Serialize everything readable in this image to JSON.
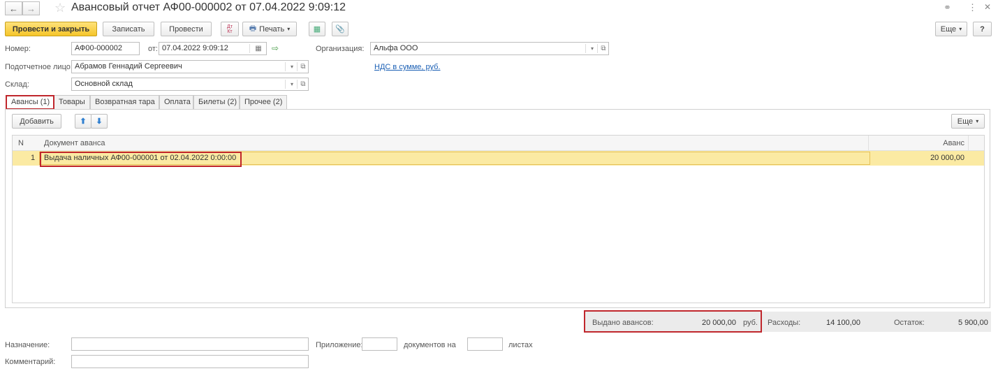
{
  "window": {
    "title": "Авансовый отчет АФ00-000002 от 07.04.2022 9:09:12"
  },
  "toolbar": {
    "post_close": "Провести и закрыть",
    "save": "Записать",
    "post": "Провести",
    "dt_kt": "Дт Кт",
    "print": "Печать",
    "more": "Еще",
    "help": "?"
  },
  "form": {
    "number_label": "Номер:",
    "number_value": "АФ00-000002",
    "date_label": "от:",
    "date_value": "07.04.2022  9:09:12",
    "org_label": "Организация:",
    "org_value": "Альфа ООО",
    "person_label": "Подотчетное лицо:",
    "person_value": "Абрамов Геннадий Сергеевич",
    "vat_link": "НДС в сумме, руб.",
    "warehouse_label": "Склад:",
    "warehouse_value": "Основной склад"
  },
  "tabs": [
    {
      "label": "Авансы (1)",
      "active": true
    },
    {
      "label": "Товары",
      "active": false
    },
    {
      "label": "Возвратная тара",
      "active": false
    },
    {
      "label": "Оплата",
      "active": false
    },
    {
      "label": "Билеты (2)",
      "active": false
    },
    {
      "label": "Прочее (2)",
      "active": false
    }
  ],
  "table_toolbar": {
    "add": "Добавить",
    "more": "Еще"
  },
  "table": {
    "columns": {
      "n": "N",
      "doc": "Документ аванса",
      "amount": "Аванс"
    },
    "rows": [
      {
        "n": "1",
        "doc": "Выдача наличных АФ00-000001 от 02.04.2022 0:00:00",
        "amount": "20 000,00"
      }
    ]
  },
  "totals": {
    "issued_label": "Выдано авансов:",
    "issued_value": "20 000,00",
    "currency": "руб.",
    "expenses_label": "Расходы:",
    "expenses_value": "14 100,00",
    "balance_label": "Остаток:",
    "balance_value": "5 900,00"
  },
  "footer": {
    "purpose_label": "Назначение:",
    "purpose_value": "",
    "attachment_label": "Приложение:",
    "attachment_value": "",
    "docs_on_label": "документов на",
    "sheets_value": "",
    "sheets_label": "листах",
    "comment_label": "Комментарий:",
    "comment_value": ""
  },
  "colors": {
    "primary_button": "#f5c52a",
    "selected_row": "#fbeaa3",
    "highlight_box": "#c0262c",
    "link": "#1a5fb4"
  },
  "icons": [
    "back-arrow-icon",
    "forward-arrow-icon",
    "star-icon",
    "link-icon",
    "kebab-menu-icon",
    "close-icon",
    "dt-kt-icon",
    "printer-icon",
    "structure-icon",
    "paperclip-icon",
    "calendar-icon",
    "post-status-icon",
    "dropdown-icon",
    "open-icon",
    "arrow-up-icon",
    "arrow-down-icon"
  ]
}
